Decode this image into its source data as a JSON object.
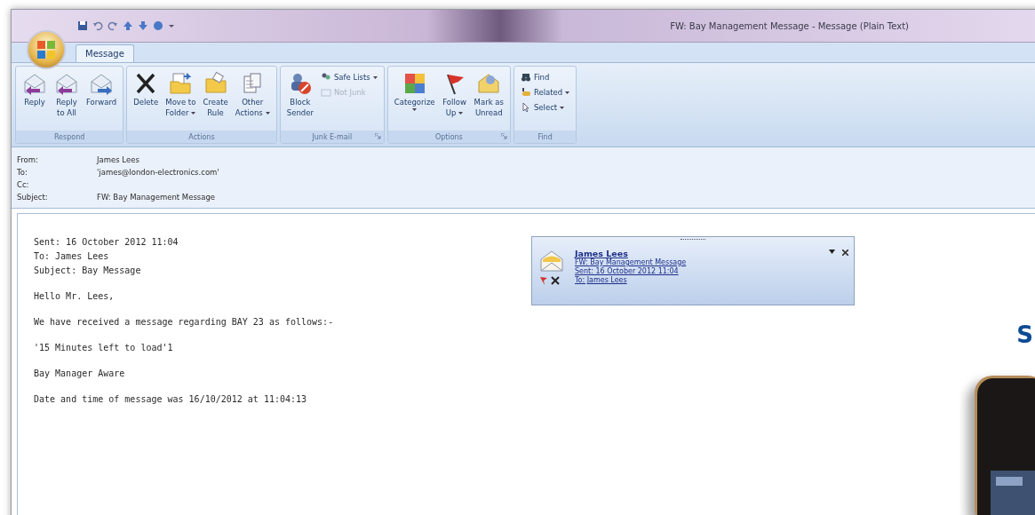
{
  "window": {
    "title": "FW: Bay Management Message - Message (Plain Text)"
  },
  "tabs": [
    {
      "label": "Message",
      "selected": true
    }
  ],
  "ribbon": {
    "groups": [
      {
        "label": "Respond",
        "launcher": false,
        "buttons": [
          {
            "kind": "large",
            "lines": [
              "Reply"
            ],
            "dropdown": false,
            "disabled": false
          },
          {
            "kind": "large",
            "lines": [
              "Reply",
              "to All"
            ],
            "dropdown": false,
            "disabled": false
          },
          {
            "kind": "large",
            "lines": [
              "Forward"
            ],
            "dropdown": false,
            "disabled": false
          }
        ]
      },
      {
        "label": "Actions",
        "launcher": false,
        "buttons": [
          {
            "kind": "large",
            "lines": [
              "Delete"
            ],
            "dropdown": false,
            "disabled": false
          },
          {
            "kind": "large",
            "lines": [
              "Move to",
              "Folder"
            ],
            "dropdown": true,
            "disabled": false
          },
          {
            "kind": "large",
            "lines": [
              "Create",
              "Rule"
            ],
            "dropdown": false,
            "disabled": false
          },
          {
            "kind": "large",
            "lines": [
              "Other",
              "Actions"
            ],
            "dropdown": true,
            "disabled": false
          }
        ]
      },
      {
        "label": "Junk E-mail",
        "launcher": true,
        "buttons": [
          {
            "kind": "large",
            "lines": [
              "Block",
              "Sender"
            ],
            "dropdown": false,
            "disabled": false
          },
          {
            "kind": "small",
            "lines": [
              "Safe Lists"
            ],
            "dropdown": true,
            "disabled": false
          },
          {
            "kind": "small",
            "lines": [
              "Not Junk"
            ],
            "dropdown": false,
            "disabled": true
          }
        ]
      },
      {
        "label": "Options",
        "launcher": true,
        "buttons": [
          {
            "kind": "large",
            "lines": [
              "Categorize"
            ],
            "dropdown": true,
            "disabled": false
          },
          {
            "kind": "large",
            "lines": [
              "Follow",
              "Up"
            ],
            "dropdown": true,
            "disabled": false
          },
          {
            "kind": "large",
            "lines": [
              "Mark as",
              "Unread"
            ],
            "dropdown": false,
            "disabled": false
          }
        ]
      },
      {
        "label": "Find",
        "launcher": false,
        "buttons": [
          {
            "kind": "small",
            "lines": [
              "Find"
            ],
            "dropdown": false,
            "disabled": false
          },
          {
            "kind": "small",
            "lines": [
              "Related"
            ],
            "dropdown": true,
            "disabled": false
          },
          {
            "kind": "small",
            "lines": [
              "Select"
            ],
            "dropdown": true,
            "disabled": false
          }
        ]
      }
    ]
  },
  "header": [
    {
      "label": "From:",
      "value": "James Lees"
    },
    {
      "label": "To:",
      "value": "'james@london-electronics.com'"
    },
    {
      "label": "Cc:"
    },
    {
      "label": "Subject:",
      "value": "FW: Bay Management Message"
    }
  ],
  "body": [
    [
      "Sent: 16 October 2012 11:04",
      "To: James Lees",
      "Subject: Bay Message"
    ],
    [
      "Hello Mr. Lees,"
    ],
    [
      "We have received a message regarding BAY 23 as follows:-"
    ],
    [
      "'15 Minutes left to load'1"
    ],
    [
      "Bay Manager Aware"
    ],
    [
      "Date and time of message was 16/10/2012 at 11:04:13"
    ]
  ],
  "notification": {
    "sender": "James Lees",
    "subject": "FW: Bay Management Message",
    "sent": "Sent: 16 October 2012 11:04",
    "to": "To: James Lees"
  },
  "overlay": {
    "text": "S",
    "kind": "picture"
  }
}
